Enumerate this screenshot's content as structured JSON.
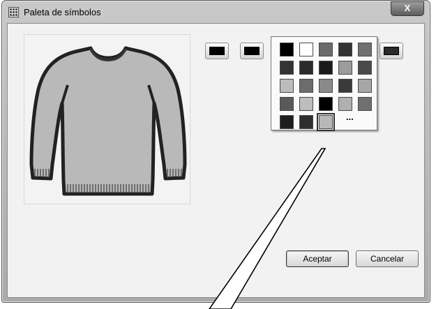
{
  "window": {
    "title": "Paleta de símbolos",
    "close_label": "X"
  },
  "icons": {
    "app": "palette-grid-icon",
    "close": "close-icon",
    "symbol": "sweater-symbol"
  },
  "color_buttons": [
    {
      "color": "#000000"
    },
    {
      "color": "#000000"
    },
    {
      "color": "#b8b8b8",
      "active": true
    },
    {
      "color": "#6e6e6e"
    },
    {
      "color": "#1e1e1e"
    },
    {
      "color": "#2a2a2a"
    }
  ],
  "palette": {
    "rows": [
      [
        "#000000",
        "#ffffff",
        "#6b6b6b",
        "#333333",
        "#707070"
      ],
      [
        "#333333",
        "#2b2b2b",
        "#1a1a1a",
        "#9c9c9c",
        "#4a4a4a"
      ],
      [
        "#bcbcbc",
        "#6c6c6c",
        "#8a8a8a",
        "#3a3a3a",
        "#a6a6a6"
      ],
      [
        "#5a5a5a",
        "#bdbdbd",
        "#000000",
        "#b0b0b0",
        "#707070"
      ],
      [
        "#1e1e1e",
        "#2e2e2e",
        "#b8b8b8"
      ]
    ],
    "selected": "4.2",
    "more_label": "..."
  },
  "buttons": {
    "accept_label": "Aceptar",
    "cancel_label": "Cancelar"
  }
}
